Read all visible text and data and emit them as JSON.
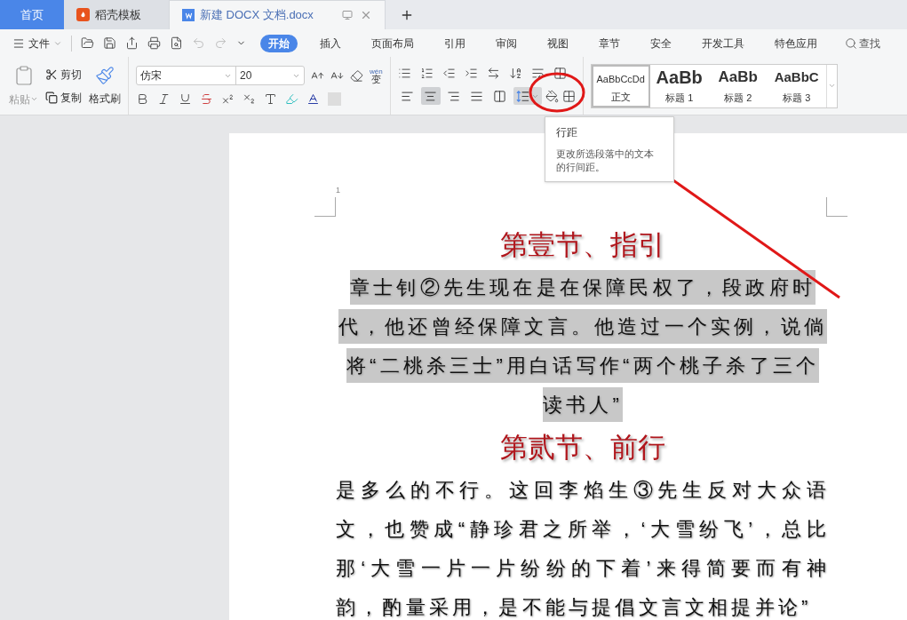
{
  "tabs": [
    {
      "kind": "home",
      "label": "首页",
      "selected": false
    },
    {
      "kind": "template",
      "label": "稻壳模板",
      "selected": false
    },
    {
      "kind": "document",
      "label": "新建 DOCX 文档.docx",
      "selected": true
    }
  ],
  "menu": {
    "file": "文件",
    "ribbon_tabs": [
      {
        "label": "开始",
        "selected": true
      },
      {
        "label": "插入",
        "selected": false
      },
      {
        "label": "页面布局",
        "selected": false
      },
      {
        "label": "引用",
        "selected": false
      },
      {
        "label": "审阅",
        "selected": false
      },
      {
        "label": "视图",
        "selected": false
      },
      {
        "label": "章节",
        "selected": false
      },
      {
        "label": "安全",
        "selected": false
      },
      {
        "label": "开发工具",
        "selected": false
      },
      {
        "label": "特色应用",
        "selected": false
      }
    ],
    "search": "查找"
  },
  "clipboard": {
    "paste": "粘贴",
    "cut": "剪切",
    "copy": "复制",
    "format_painter": "格式刷"
  },
  "font": {
    "name": "仿宋",
    "size": "20",
    "phonetic_top": "wén",
    "phonetic_bottom": "变"
  },
  "alignment": [
    {
      "kind": "left",
      "selected": false
    },
    {
      "kind": "center",
      "selected": true
    },
    {
      "kind": "right",
      "selected": false
    },
    {
      "kind": "justify",
      "selected": false
    },
    {
      "kind": "distributed",
      "selected": false
    }
  ],
  "line_spacing": {
    "highlighted": true
  },
  "styles": [
    {
      "kind": "body",
      "sample": "AaBbCcDd",
      "label": "正文",
      "selected": true
    },
    {
      "kind": "h1",
      "sample": "AaBb",
      "label": "标题 1",
      "selected": false
    },
    {
      "kind": "h2",
      "sample": "AaBb",
      "label": "标题 2",
      "selected": false
    },
    {
      "kind": "h3",
      "sample": "AaBbC",
      "label": "标题 3",
      "selected": false
    }
  ],
  "tooltip": {
    "title": "行距",
    "text": "更改所选段落中的文本的行间距。"
  },
  "document": {
    "page_number": "1",
    "blocks": [
      {
        "kind": "heading",
        "text": "第壹节、指引"
      },
      {
        "kind": "paragraph",
        "text": "章士钊②先生现在是在保障民权了，段政府时代，他还曾经保障文言。他造过一个实例，说倘将“二桃杀三士”用白话写作“两个桃子杀了三个读书人”",
        "selected": true
      },
      {
        "kind": "heading",
        "text": "第贰节、前行"
      },
      {
        "kind": "paragraph",
        "text": "是多么的不行。这回李焰生③先生反对大众语文，也赞成“静珍君之所举，‘大雪纷飞’，总比那‘大雪一片一片纷纷的下着’来得简要而有神韵，酌量采用，是不能与提倡文言文相提并论”",
        "selected": false
      }
    ]
  }
}
